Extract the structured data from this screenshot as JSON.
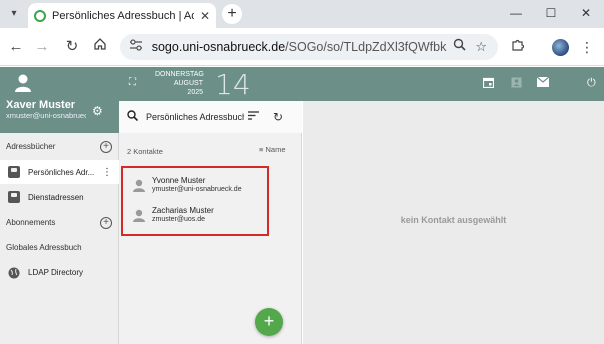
{
  "browser": {
    "tab_title": "Persönliches Adressbuch | Adre",
    "tab_close": "✕",
    "new_tab": "+",
    "window_controls": [
      "—",
      "☐",
      "✕"
    ],
    "url_domain": "sogo.uni-osnabrueck.de",
    "url_path": "/SOGo/so/TLdpZdXl3fQWfbksH..."
  },
  "icons": {
    "back": "arrow-left-icon",
    "forward": "arrow-right-icon",
    "reload": "reload-icon",
    "home": "home-icon",
    "zoom": "zoom-icon",
    "bookmark": "star-icon",
    "extensions": "puzzle-icon",
    "menu": "kebab-icon"
  },
  "user": {
    "name": "Xaver Muster",
    "email": "xmuster@uni-osnabruec..."
  },
  "sidebar": {
    "addressbooks_label": "Adressbücher",
    "items": [
      {
        "label": "Persönliches Adr...",
        "active": true
      },
      {
        "label": "Dienstadressen",
        "active": false
      }
    ],
    "subscriptions_label": "Abonnements",
    "global_label": "Globales Adressbuch",
    "ldap_label": "LDAP Directory"
  },
  "topbar": {
    "weekday": "DONNERSTAG",
    "month": "AUGUST",
    "year": "2025",
    "day": "14"
  },
  "list": {
    "title": "Persönliches Adressbuch",
    "count": "2 Kontakte",
    "sort_label": "Name",
    "contacts": [
      {
        "name": "Yvonne Muster",
        "email": "ymuster@uni-osnabrueck.de"
      },
      {
        "name": "Zacharias Muster",
        "email": "zmuster@uos.de"
      }
    ],
    "add_label": "+"
  },
  "detail": {
    "empty_message": "kein Kontakt ausgewählt"
  },
  "colors": {
    "header": "#6c8f87",
    "accent": "#52a84a",
    "highlight": "#d42a2a"
  }
}
